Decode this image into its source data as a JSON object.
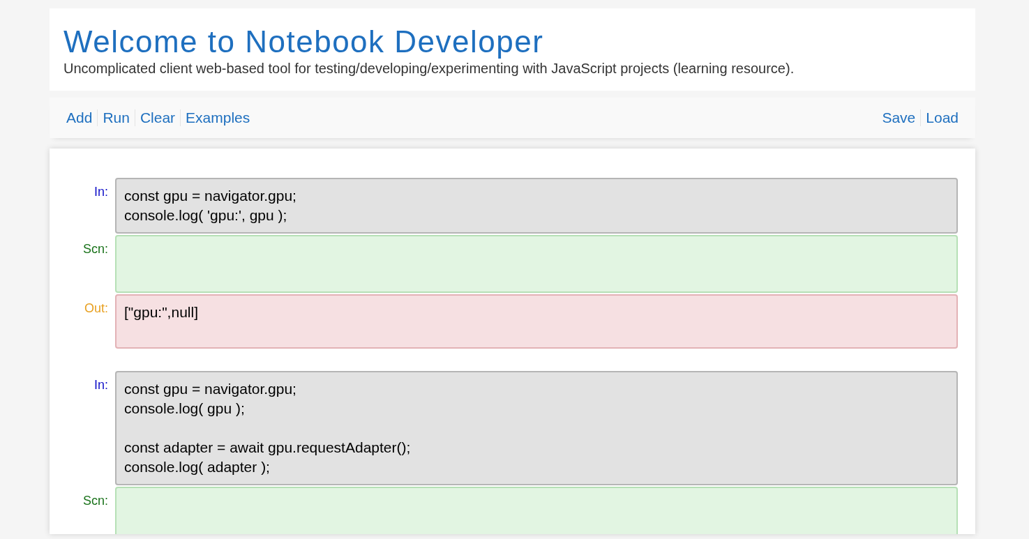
{
  "header": {
    "title": "Welcome to Notebook Developer",
    "subtitle": "Uncomplicated client web-based tool for testing/developing/experimenting with JavaScript projects (learning resource)."
  },
  "toolbar": {
    "left": [
      "Add",
      "Run",
      "Clear",
      "Examples"
    ],
    "right": [
      "Save",
      "Load"
    ]
  },
  "cells": [
    {
      "blocks": [
        {
          "kind": "in",
          "label": "In:",
          "text": "const gpu = navigator.gpu;\nconsole.log( 'gpu:', gpu );"
        },
        {
          "kind": "scn",
          "label": "Scn:"
        },
        {
          "kind": "out",
          "label": "Out:",
          "text": "[\"gpu:\",null]"
        }
      ]
    },
    {
      "blocks": [
        {
          "kind": "in",
          "label": "In:",
          "text": "const gpu = navigator.gpu;\nconsole.log( gpu );\n\nconst adapter = await gpu.requestAdapter();\nconsole.log( adapter );"
        },
        {
          "kind": "scn",
          "label": "Scn:"
        }
      ]
    }
  ]
}
